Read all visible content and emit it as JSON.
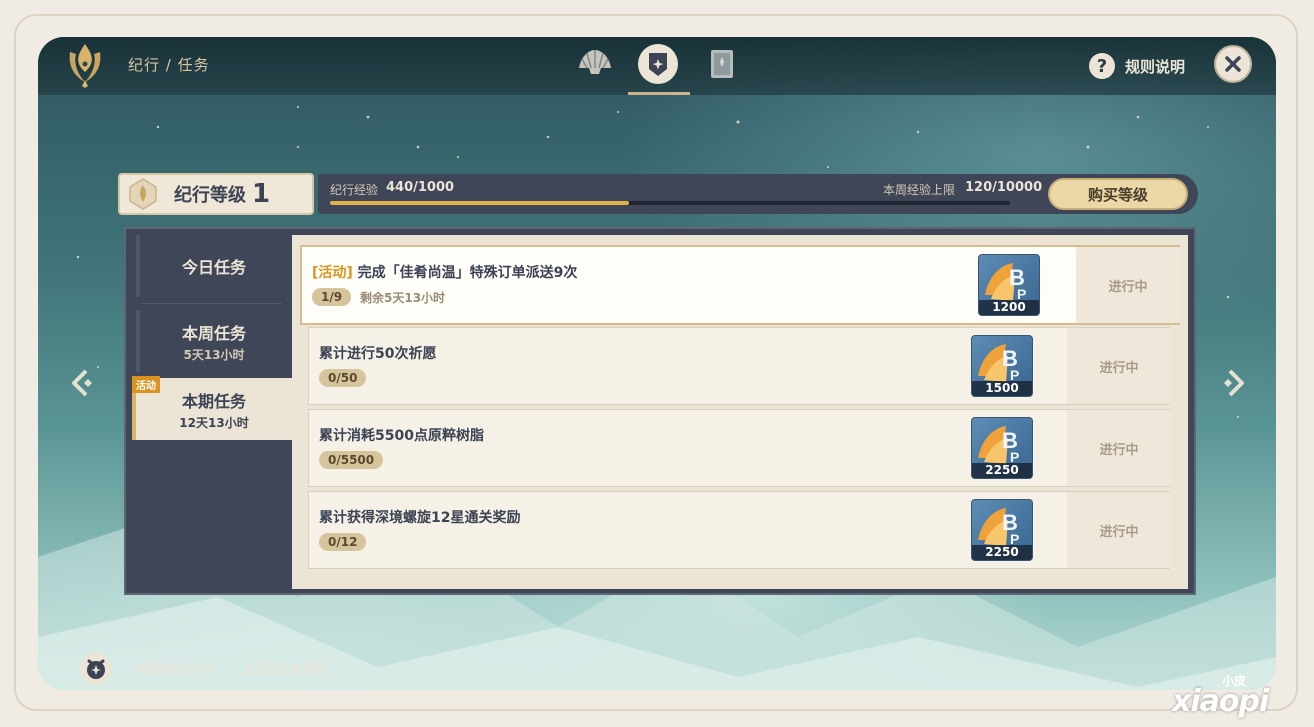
{
  "header": {
    "breadcrumb": "纪行 / 任务",
    "tabs": [
      "shell-icon",
      "badge-icon",
      "book-icon"
    ],
    "rules_label": "规则说明",
    "rules_icon": "?"
  },
  "level": {
    "label": "纪行等级",
    "value": "1",
    "exp_label": "纪行经验",
    "exp_value": "440/1000",
    "exp_fraction": 0.44,
    "weekly_label": "本周经验上限",
    "weekly_value": "120/10000",
    "buy_label": "购买等级"
  },
  "sidebar": {
    "items": [
      {
        "label": "今日任务",
        "sub": ""
      },
      {
        "label": "本周任务",
        "sub": "5天13小时"
      },
      {
        "label": "本期任务",
        "sub": "12天13小时",
        "tag": "活动"
      }
    ]
  },
  "quests": [
    {
      "tag": "[活动]",
      "title": "完成「佳肴尚温」特殊订单派送9次",
      "progress": "1/9",
      "remain": "剩余5天13小时",
      "reward": "1200",
      "status": "进行中"
    },
    {
      "tag": "",
      "title": "累计进行50次祈愿",
      "progress": "0/50",
      "remain": "",
      "reward": "1500",
      "status": "进行中"
    },
    {
      "tag": "",
      "title": "累计消耗5500点原粹树脂",
      "progress": "0/5500",
      "remain": "",
      "reward": "2250",
      "status": "进行中"
    },
    {
      "tag": "",
      "title": "累计获得深境螺旋12星通关奖励",
      "progress": "0/12",
      "remain": "",
      "reward": "2250",
      "status": "进行中"
    }
  ],
  "footer": {
    "label": "本期剩余时间:",
    "value": "12天13小时"
  },
  "watermark": {
    "sub": "小皮",
    "main": "xiaopi"
  },
  "colors": {
    "accent": "#e2b24a",
    "event": "#d9941f",
    "panel": "#3e4658",
    "cream": "#ece5d6"
  }
}
